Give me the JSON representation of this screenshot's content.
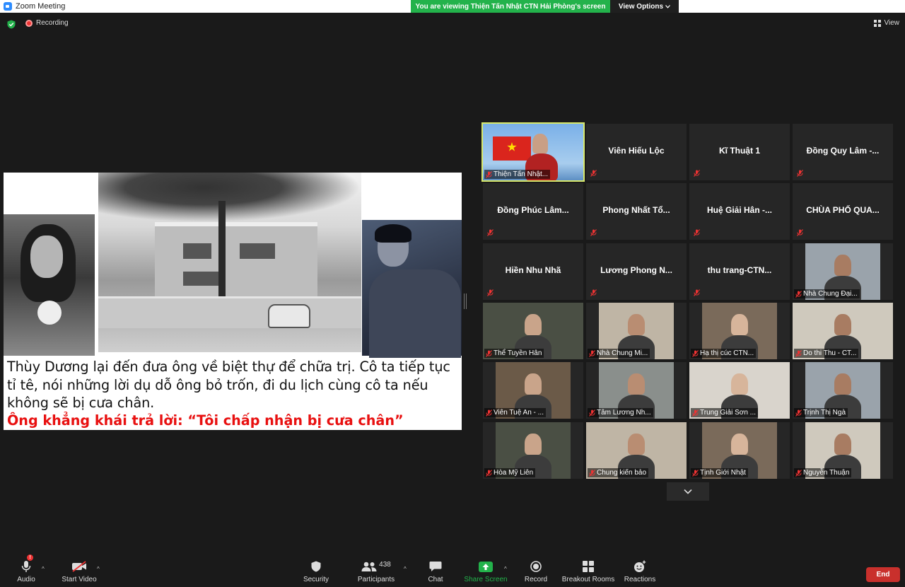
{
  "window": {
    "title": "Zoom Meeting"
  },
  "banner": {
    "viewing": "You are viewing Thiện Tấn Nhật CTN Hải Phòng's screen",
    "view_options": "View Options"
  },
  "top": {
    "recording": "Recording",
    "view": "View"
  },
  "slide": {
    "text": "Thùy Dương lại đến đưa ông về biệt thự để chữa trị. Cô ta tiếp tục tỉ tê, nói những lời dụ dỗ ông bỏ trốn, đi du lịch cùng cô ta nếu không sẽ bị cưa chân.",
    "highlight": "Ông khẳng khái trả lời: “Tôi chấp nhận bị cưa chân”"
  },
  "participants": [
    {
      "name": "Thiện Tấn Nhật...",
      "video": true,
      "active": true
    },
    {
      "name": "Viên Hiếu Lộc",
      "video": false
    },
    {
      "name": "Kĩ Thuật 1",
      "video": false
    },
    {
      "name": "Đồng Quy Lâm -...",
      "video": false
    },
    {
      "name": "Đồng Phúc Lâm...",
      "video": false
    },
    {
      "name": "Phong Nhất Tổ...",
      "video": false
    },
    {
      "name": "Huệ Giải Hân -...",
      "video": false
    },
    {
      "name": "CHÙA PHỐ QUA...",
      "video": false
    },
    {
      "name": "Hiền Nhu Nhã",
      "video": false
    },
    {
      "name": "Lương Phong N...",
      "video": false
    },
    {
      "name": "thu trang-CTN...",
      "video": false
    },
    {
      "name": "Nhà Chung Đại...",
      "video": true
    },
    {
      "name": "Thể Tuyền Hân",
      "video": true
    },
    {
      "name": "Nhà Chung Mi...",
      "video": true
    },
    {
      "name": "Hạ thị cúc CTN...",
      "video": true
    },
    {
      "name": "Do thi Thu - CT...",
      "video": true
    },
    {
      "name": "Viên Tuệ An - ...",
      "video": true
    },
    {
      "name": "Tâm Lương Nh...",
      "video": true
    },
    {
      "name": "Trung Giải Sơn ...",
      "video": true
    },
    {
      "name": "Trịnh Thị Ngà",
      "video": true
    },
    {
      "name": "Hòa Mỹ Liên",
      "video": true
    },
    {
      "name": "Chung kiến bảo",
      "video": true
    },
    {
      "name": "Tịnh Giới Nhật",
      "video": true
    },
    {
      "name": "Nguyễn Thuận",
      "video": true
    }
  ],
  "toolbar": {
    "audio": "Audio",
    "start_video": "Start Video",
    "security": "Security",
    "participants": "Participants",
    "participants_count": "438",
    "chat": "Chat",
    "share_screen": "Share Screen",
    "record": "Record",
    "breakout_rooms": "Breakout Rooms",
    "reactions": "Reactions",
    "end": "End",
    "audio_badge": "!"
  },
  "colors": {
    "share_green": "#23b24b",
    "end_red": "#c9302c",
    "active_speaker": "#d8e86a",
    "slide_red": "#e81010"
  }
}
